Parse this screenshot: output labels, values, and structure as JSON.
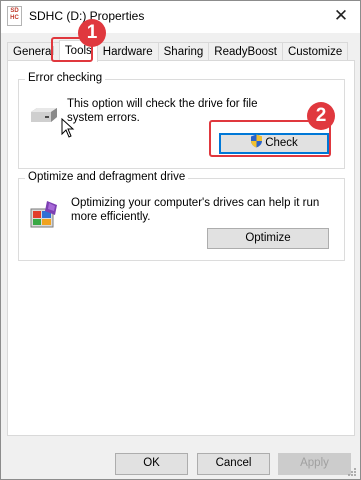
{
  "window": {
    "title": "SDHC (D:) Properties",
    "icon_text": "SD HC",
    "close_glyph": "✕"
  },
  "tabs": [
    {
      "label": "General",
      "active": false
    },
    {
      "label": "Tools",
      "active": true
    },
    {
      "label": "Hardware",
      "active": false
    },
    {
      "label": "Sharing",
      "active": false
    },
    {
      "label": "ReadyBoost",
      "active": false
    },
    {
      "label": "Customize",
      "active": false
    }
  ],
  "error_checking": {
    "title": "Error checking",
    "description": "This option will check the drive for file system errors.",
    "button_label": "Check",
    "icon": "drive-icon",
    "button_icon": "uac-shield-icon"
  },
  "optimize": {
    "title": "Optimize and defragment drive",
    "description": "Optimizing your computer's drives can help it run more efficiently.",
    "button_label": "Optimize",
    "icon": "defrag-icon"
  },
  "footer": {
    "ok_label": "OK",
    "cancel_label": "Cancel",
    "apply_label": "Apply"
  },
  "annotations": {
    "step1": "1",
    "step2": "2",
    "color": "#e0383e"
  },
  "colors": {
    "dialog_bg": "#f0f0f0",
    "panel_bg": "#ffffff",
    "focus_border": "#0078d7"
  }
}
